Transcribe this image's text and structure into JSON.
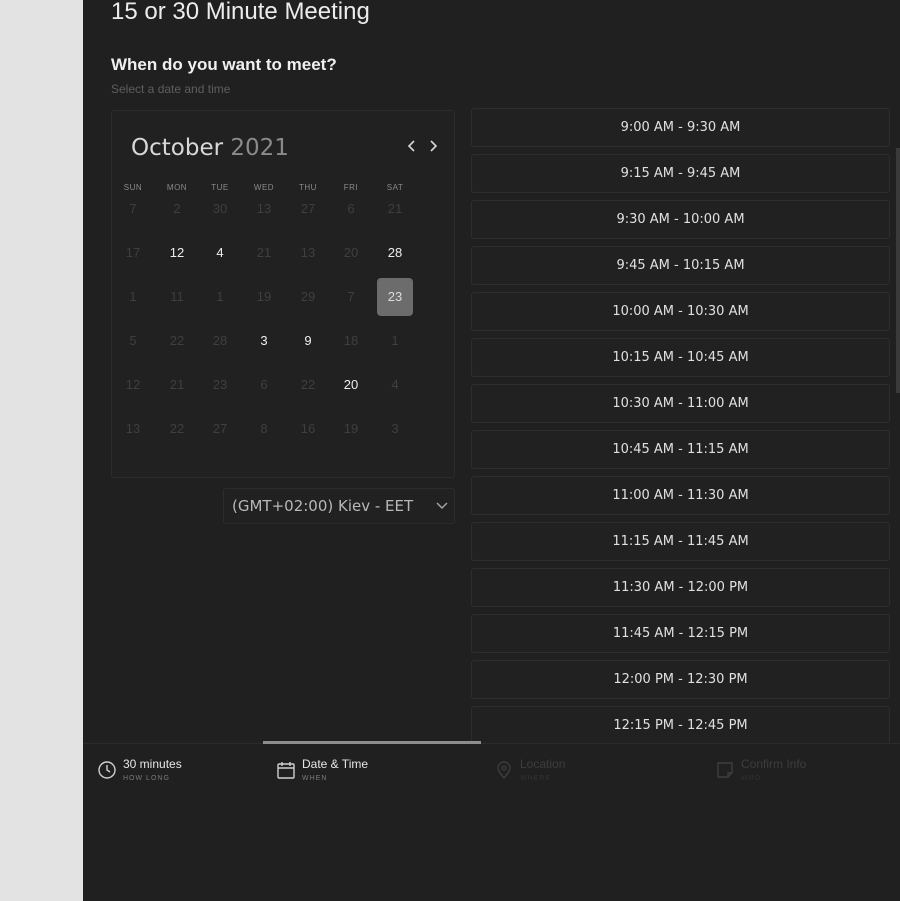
{
  "title": "15 or 30 Minute Meeting",
  "heading": "When do you want to meet?",
  "subheading": "Select a date and time",
  "calendar": {
    "month": "October",
    "year": "2021",
    "weekdays": [
      "SUN",
      "MON",
      "TUE",
      "WED",
      "THU",
      "FRI",
      "SAT"
    ],
    "weeks": [
      [
        {
          "d": "7",
          "a": false
        },
        {
          "d": "2",
          "a": false
        },
        {
          "d": "30",
          "a": false
        },
        {
          "d": "13",
          "a": false
        },
        {
          "d": "27",
          "a": false
        },
        {
          "d": "6",
          "a": false
        },
        {
          "d": "21",
          "a": false
        }
      ],
      [
        {
          "d": "17",
          "a": false
        },
        {
          "d": "12",
          "a": true
        },
        {
          "d": "4",
          "a": true
        },
        {
          "d": "21",
          "a": false
        },
        {
          "d": "13",
          "a": false
        },
        {
          "d": "20",
          "a": false
        },
        {
          "d": "28",
          "a": true
        }
      ],
      [
        {
          "d": "1",
          "a": false
        },
        {
          "d": "11",
          "a": false
        },
        {
          "d": "1",
          "a": false
        },
        {
          "d": "19",
          "a": false
        },
        {
          "d": "29",
          "a": false
        },
        {
          "d": "7",
          "a": false
        },
        {
          "d": "23",
          "a": true,
          "selected": true
        }
      ],
      [
        {
          "d": "5",
          "a": false
        },
        {
          "d": "22",
          "a": false
        },
        {
          "d": "28",
          "a": false
        },
        {
          "d": "3",
          "a": true
        },
        {
          "d": "9",
          "a": true
        },
        {
          "d": "18",
          "a": false
        },
        {
          "d": "1",
          "a": false
        }
      ],
      [
        {
          "d": "12",
          "a": false
        },
        {
          "d": "21",
          "a": false
        },
        {
          "d": "23",
          "a": false
        },
        {
          "d": "6",
          "a": false
        },
        {
          "d": "22",
          "a": false
        },
        {
          "d": "20",
          "a": true
        },
        {
          "d": "4",
          "a": false
        }
      ],
      [
        {
          "d": "13",
          "a": false
        },
        {
          "d": "22",
          "a": false
        },
        {
          "d": "27",
          "a": false
        },
        {
          "d": "8",
          "a": false
        },
        {
          "d": "16",
          "a": false
        },
        {
          "d": "19",
          "a": false
        },
        {
          "d": "3",
          "a": false
        }
      ]
    ]
  },
  "timezone": "(GMT+02:00) Kiev - EET",
  "slots": [
    "9:00 AM - 9:30 AM",
    "9:15 AM - 9:45 AM",
    "9:30 AM - 10:00 AM",
    "9:45 AM - 10:15 AM",
    "10:00 AM - 10:30 AM",
    "10:15 AM - 10:45 AM",
    "10:30 AM - 11:00 AM",
    "10:45 AM - 11:15 AM",
    "11:00 AM - 11:30 AM",
    "11:15 AM - 11:45 AM",
    "11:30 AM - 12:00 PM",
    "11:45 AM - 12:15 PM",
    "12:00 PM - 12:30 PM",
    "12:15 PM - 12:45 PM"
  ],
  "steps": [
    {
      "label": "30 minutes",
      "sub": "HOW LONG",
      "icon": "clock-icon",
      "state": "done"
    },
    {
      "label": "Date & Time",
      "sub": "WHEN",
      "icon": "calendar-icon",
      "state": "active"
    },
    {
      "label": "Location",
      "sub": "WHERE",
      "icon": "location-pin-icon",
      "state": "inactive"
    },
    {
      "label": "Confirm Info",
      "sub": "WHO",
      "icon": "note-icon",
      "state": "inactive"
    }
  ],
  "icons": {
    "prev": "chevron-left-icon",
    "next": "chevron-right-icon",
    "dropdown": "chevron-down-icon"
  },
  "colors": {
    "background": "#202020",
    "selected_day": "#6c6c6c",
    "outer": "#e3e3e3"
  }
}
